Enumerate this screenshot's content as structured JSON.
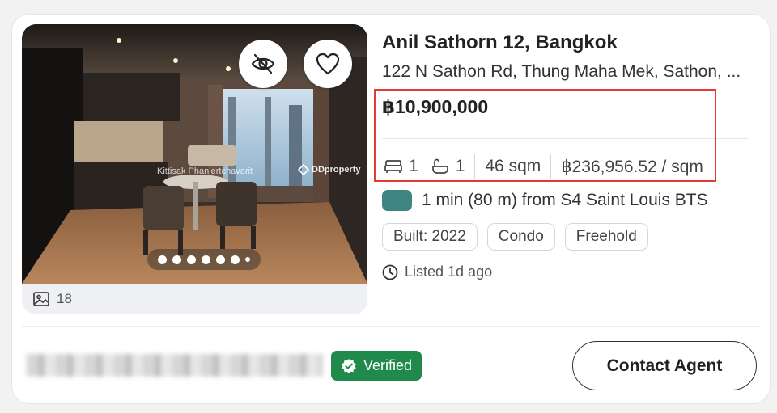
{
  "listing": {
    "title": "Anil Sathorn 12, Bangkok",
    "address": "122 N Sathon Rd, Thung Maha Mek, Sathon, ...",
    "price": "฿10,900,000",
    "specs": {
      "beds": "1",
      "baths": "1",
      "area": "46 sqm",
      "price_per_sqm": "฿236,956.52 / sqm"
    },
    "transit": "1 min (80 m) from S4 Saint Louis BTS",
    "tags": [
      "Built: 2022",
      "Condo",
      "Freehold"
    ],
    "listed": "Listed 1d ago"
  },
  "photo": {
    "watermark_author": "Kittisak Phanlertchavarit",
    "watermark_brand": "DDproperty",
    "photo_count": "18",
    "dot_count": 7,
    "active_dot": 0
  },
  "agent": {
    "verified_label": "Verified",
    "contact_label": "Contact Agent"
  },
  "colors": {
    "transit_badge": "#3f8582",
    "verified_bg": "#1f8a4c",
    "highlight": "#e53935"
  }
}
